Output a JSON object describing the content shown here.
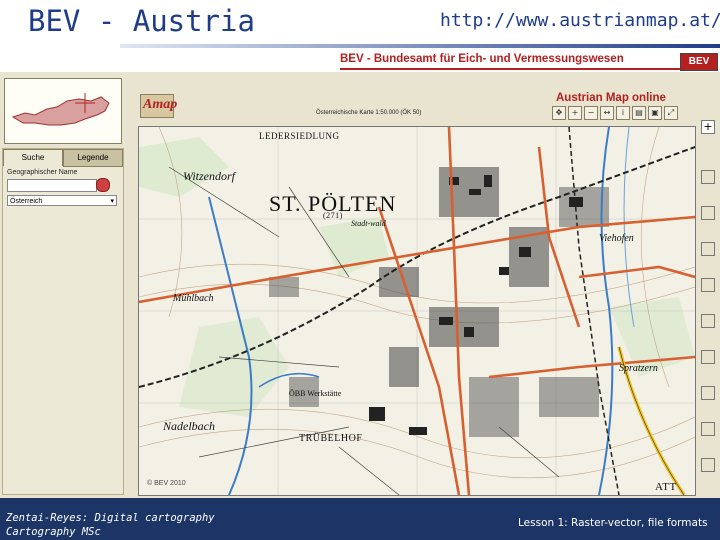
{
  "slide": {
    "title": "BEV - Austria",
    "url": "http://www.austrianmap.at/"
  },
  "app": {
    "header_title": "BEV - Bundesamt für Eich- und Vermessungswesen",
    "logo_text": "BEV",
    "map_product_logo": "Amap",
    "service_title": "Austrian Map online",
    "sheet_label": "Österreichische Karte 1:50.000 (ÖK 50)",
    "tabs": [
      {
        "label": "Suche",
        "active": true
      },
      {
        "label": "Legende",
        "active": false
      }
    ],
    "search": {
      "field_label": "Geographischer Name",
      "input_value": "",
      "region_value": "Österreich"
    },
    "toolbar_icons": [
      "pan-icon",
      "zoom-in-icon",
      "zoom-out-icon",
      "measure-icon",
      "info-icon",
      "print-icon",
      "overview-icon",
      "extent-icon"
    ],
    "map": {
      "copyright": "© BEV 2010",
      "place_labels": {
        "city": "ST. PÖLTEN",
        "city_elevation": "(271)",
        "settlement_top": "LEDERSIEDLUNG",
        "wetzendorf": "Witzendorf",
        "stadtwald": "Stadt-wald",
        "muehlbach": "Mühlbach",
        "nadelbach": "Nadelbach",
        "truebelhof": "TRÜBELHOF",
        "oebb": "ÖBB Werkstätte",
        "viehofen": "Viehofen",
        "spratzern": "Spratzern",
        "east_edge": "ATT"
      }
    }
  },
  "footer": {
    "left_line1": "Zentai-Reyes: Digital cartography",
    "left_line2": "Cartography MSc",
    "right": "Lesson 1: Raster-vector, file formats"
  },
  "colors": {
    "title_blue": "#1f3c8a",
    "footer_bg": "#1c3566",
    "bev_red": "#b42020",
    "road_orange": "#d86030"
  }
}
